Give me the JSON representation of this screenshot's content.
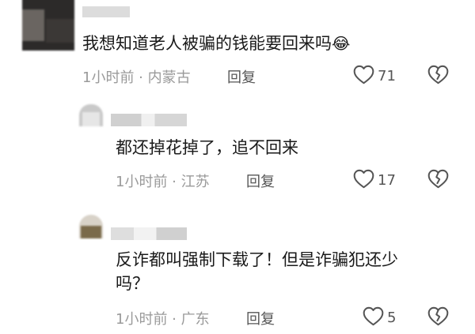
{
  "comments": [
    {
      "text": "我想知道老人被骗的钱能要回来吗",
      "emoji": "😂",
      "meta": "1小时前 · 内蒙古",
      "reply_label": "回复",
      "likes": "71"
    },
    {
      "text": "都还掉花掉了，追不回来",
      "meta": "1小时前 · 江苏",
      "reply_label": "回复",
      "likes": "17"
    },
    {
      "text_line1": "反诈都叫强制下载了！但是诈骗犯还少",
      "text_line2": "吗？",
      "meta": "1小时前 · 广东",
      "reply_label": "回复",
      "likes": "5"
    }
  ],
  "icons": {
    "like": "heart-outline-icon",
    "dislike": "broken-heart-icon"
  }
}
